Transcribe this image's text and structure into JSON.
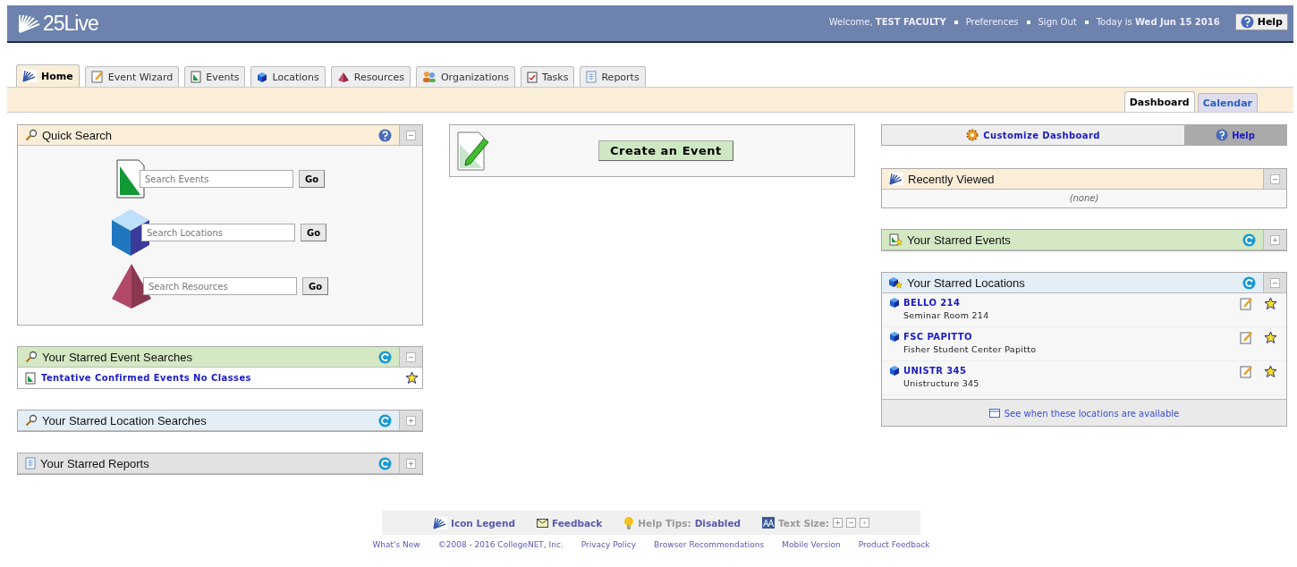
{
  "header": {
    "logo": "25Live",
    "welcome": "Welcome,",
    "user": "TEST FACULTY",
    "links": [
      "Preferences",
      "Sign Out"
    ],
    "today": "Today is",
    "date": "Wed Jun 15 2016",
    "help": "Help"
  },
  "tabs": [
    {
      "label": "Home",
      "kind": "home",
      "selected": true
    },
    {
      "label": "Event Wizard",
      "kind": "wizard",
      "selected": false
    },
    {
      "label": "Events",
      "kind": "events",
      "selected": false
    },
    {
      "label": "Locations",
      "kind": "locations",
      "selected": false
    },
    {
      "label": "Resources",
      "kind": "resources",
      "selected": false
    },
    {
      "label": "Organizations",
      "kind": "organizations",
      "selected": false
    },
    {
      "label": "Tasks",
      "kind": "tasks",
      "selected": false
    },
    {
      "label": "Reports",
      "kind": "reports",
      "selected": false
    }
  ],
  "subtabs": [
    {
      "label": "Dashboard",
      "selected": true
    },
    {
      "label": "Calendar",
      "selected": false
    }
  ],
  "left_panels": [
    {
      "kind": "quick_search",
      "title": "Quick Search",
      "color": "#faeed9",
      "help_icon": true,
      "expanded": true,
      "searches": [
        {
          "kind": "events",
          "placeholder": "Search Events",
          "button": "Go"
        },
        {
          "kind": "locations",
          "placeholder": "Search Locations",
          "button": "Go"
        },
        {
          "kind": "resources",
          "placeholder": "Search Resources",
          "button": "Go"
        }
      ]
    },
    {
      "kind": "searches",
      "title": "Your Starred Event Searches",
      "color": "#d3e8c3",
      "refreshable": true,
      "expanded": true,
      "items": [
        {
          "label": "Tentative Confirmed Events No Classes"
        }
      ]
    },
    {
      "kind": "searches",
      "title": "Your Starred Location Searches",
      "color": "#e3eef6",
      "refreshable": true,
      "expanded": false
    },
    {
      "kind": "reports",
      "title": "Your Starred Reports",
      "color": "#e2e2e2",
      "refreshable": true,
      "expanded": false
    }
  ],
  "create_event": {
    "button": "Create an Event"
  },
  "customize": {
    "label": "Customize Dashboard",
    "help": "Help"
  },
  "right_panels": [
    {
      "kind": "recent",
      "title": "Recently Viewed",
      "color": "#faeed9",
      "expanded": true,
      "empty": "(none)"
    },
    {
      "kind": "starred_events",
      "title": "Your Starred Events",
      "color": "#d3e8c3",
      "refreshable": true,
      "expanded": false
    },
    {
      "kind": "starred_locations",
      "title": "Your Starred Locations",
      "color": "#e3eef6",
      "refreshable": true,
      "expanded": true,
      "locations": [
        {
          "name": "BELLO 214",
          "description": "Seminar Room 214"
        },
        {
          "name": "FSC PAPITTO",
          "description": "Fisher Student Center Papitto"
        },
        {
          "name": "UNISTR 345",
          "description": "Unistructure 345"
        }
      ],
      "footer_link": "See when these locations are available"
    }
  ],
  "footer": {
    "icon_legend": "Icon Legend",
    "feedback": "Feedback",
    "help_tips_label": "Help Tips:",
    "help_tips_value": "Disabled",
    "text_size_label": "Text Size:",
    "links": [
      "What's New",
      "©2008 - 2016 CollegeNET, Inc.",
      "Privacy Policy",
      "Browser Recommendations",
      "Mobile Version",
      "Product Feedback"
    ]
  }
}
